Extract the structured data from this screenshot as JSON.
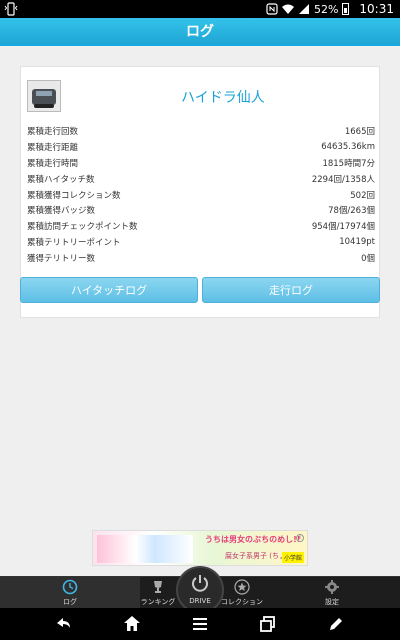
{
  "status_bar": {
    "battery_percent": "52%",
    "time": "10:31"
  },
  "header": {
    "title": "ログ"
  },
  "profile": {
    "name": "ハイドラ仙人"
  },
  "stats": [
    {
      "label": "累積走行回数",
      "value": "1665回"
    },
    {
      "label": "累積走行距離",
      "value": "64635.36km"
    },
    {
      "label": "累積走行時間",
      "value": "1815時間7分"
    },
    {
      "label": "累積ハイタッチ数",
      "value": "2294回/1358人"
    },
    {
      "label": "累積獲得コレクション数",
      "value": "502回"
    },
    {
      "label": "累積獲得バッジ数",
      "value": "78個/263個"
    },
    {
      "label": "累積訪問チェックポイント数",
      "value": "954個/17974個"
    },
    {
      "label": "累積テリトリーポイント",
      "value": "10419pt"
    },
    {
      "label": "獲得テリトリー数",
      "value": "0個"
    }
  ],
  "buttons": {
    "hightouch_log": "ハイタッチログ",
    "drive_log": "走行ログ"
  },
  "ad": {
    "headline": "うちは男女のぶちのめし!!",
    "title": "腐女子系男子 (ちょっと)",
    "publisher": "小学館",
    "info": "i"
  },
  "tabs": [
    {
      "label": "ログ",
      "icon": "clock-icon",
      "active": true
    },
    {
      "label": "ランキング",
      "icon": "trophy-icon",
      "active": false
    },
    {
      "label": "DRIVE",
      "icon": "power-icon",
      "active": false
    },
    {
      "label": "コレクション",
      "icon": "star-icon",
      "active": false
    },
    {
      "label": "設定",
      "icon": "gear-icon",
      "active": false
    }
  ],
  "colors": {
    "accent": "#1fa6d6",
    "name_color": "#1aa3d8",
    "button": "#6cc7ea"
  }
}
